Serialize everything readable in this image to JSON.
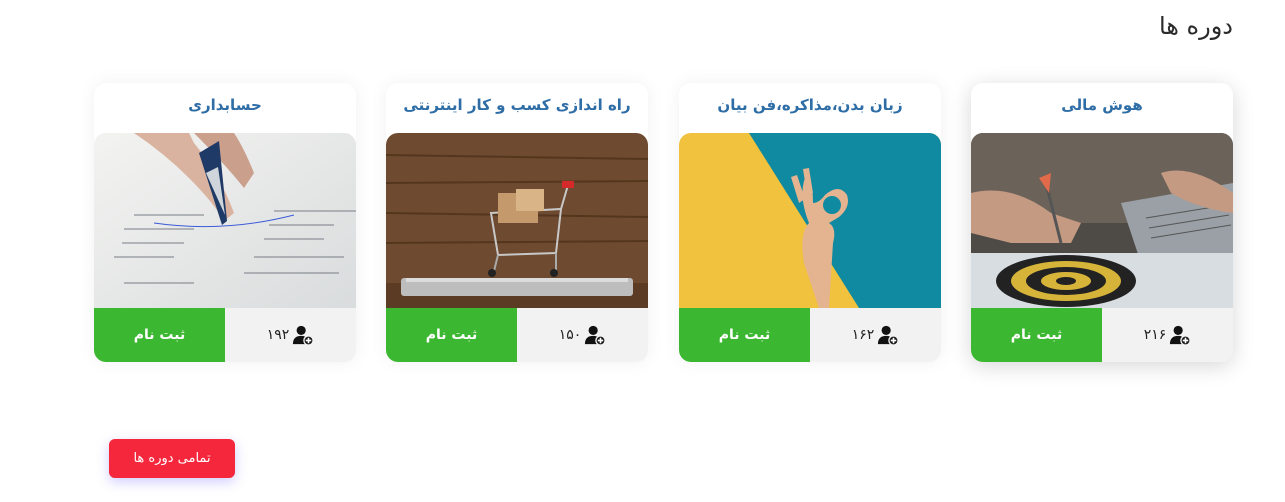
{
  "section": {
    "title": "دوره ها"
  },
  "courses": [
    {
      "title": "حسابداری",
      "enrolled": "۱۹۲",
      "cta": "ثبت نام",
      "image": "accounting-photo"
    },
    {
      "title": "راه اندازی کسب و کار اینترنتی",
      "enrolled": "۱۵۰",
      "cta": "ثبت نام",
      "image": "shopping-cart-photo"
    },
    {
      "title": "زبان بدن،مذاکره،فن بیان",
      "enrolled": "۱۶۲",
      "cta": "ثبت نام",
      "image": "ok-hand-photo"
    },
    {
      "title": "هوش مالی",
      "enrolled": "۲۱۶",
      "cta": "ثبت نام",
      "image": "dartboard-photo"
    }
  ],
  "all_courses_label": "تمامی دوره ها",
  "colors": {
    "title_blue": "#2e6da6",
    "register_green": "#3cb731",
    "cta_red": "#f5273c"
  },
  "icons": {
    "enrolled": "user-plus-icon"
  }
}
